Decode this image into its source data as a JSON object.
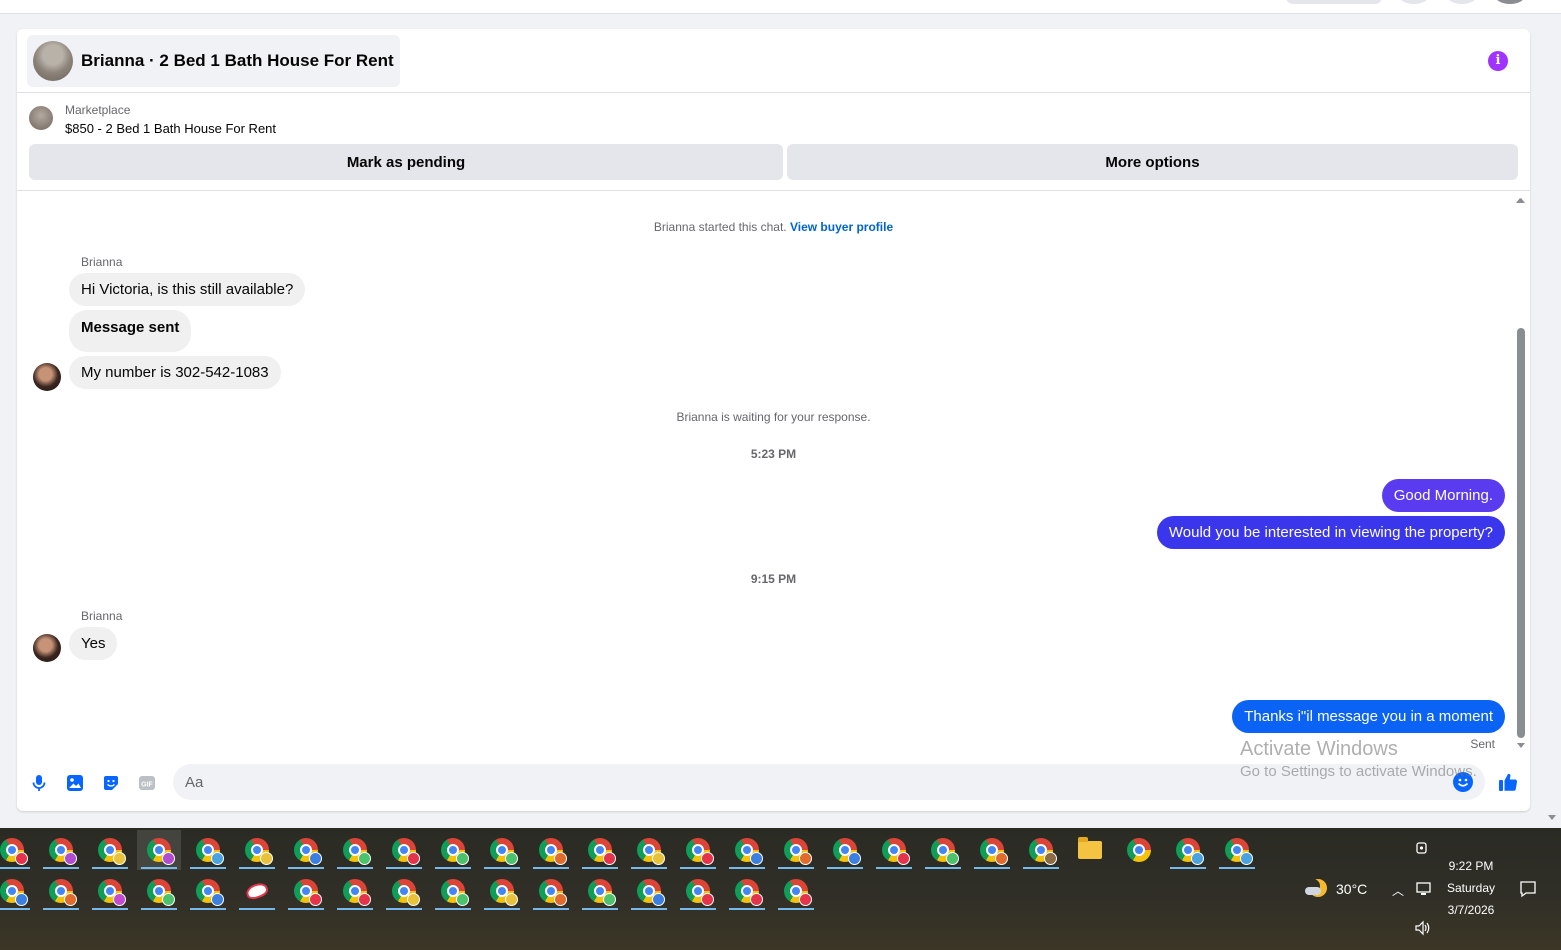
{
  "header": {
    "title": "Brianna · 2 Bed 1 Bath House For Rent",
    "info_icon": "i",
    "info_color": "#a033ff"
  },
  "listing": {
    "source": "Marketplace",
    "price_title": "$850 - 2 Bed 1 Bath House For Rent",
    "mark_pending_label": "Mark as pending",
    "more_options_label": "More options"
  },
  "chat": {
    "started_text": "Brianna started this chat.",
    "view_profile_label": "View buyer profile",
    "sender_name_1": "Brianna",
    "incoming_1": "Hi Victoria, is this still available?",
    "incoming_2": "Message sent",
    "incoming_3": "My number is 302-542-1083",
    "waiting_text": "Brianna is waiting for your response.",
    "time_1": "5:23 PM",
    "outgoing_1": "Good Morning.",
    "outgoing_2": "Would you be interested in viewing the property?",
    "time_2": "9:15 PM",
    "sender_name_2": "Brianna",
    "incoming_4": "Yes",
    "outgoing_3": "Thanks i\"il message you in a moment",
    "sent_status": "Sent",
    "outgoing_color_1": "#5b3bf0",
    "outgoing_color_2": "#3a36ec",
    "outgoing_color_3": "#0a63f5"
  },
  "composer": {
    "placeholder": "Aa",
    "icons": [
      "microphone-icon",
      "photo-icon",
      "sticker-icon",
      "gif-icon",
      "emoji-icon",
      "thumbs-up-icon"
    ],
    "gif_label": "GIF",
    "accent": "#0866ff"
  },
  "watermark": {
    "line1": "Activate Windows",
    "line2": "Go to Settings to activate Windows."
  },
  "taskbar": {
    "weather_temp": "30°C",
    "time": "9:22 PM",
    "day": "Saturday",
    "date": "3/7/2026",
    "row1_profile_colors": [
      "#e5334b",
      "#b24bd0",
      "#e7c23a",
      "#b24bd0",
      "#48a3e0",
      "#e7c23a",
      "#3b7fe0",
      "#4cc26c",
      "#e5334b",
      "#4cc26c",
      "#4cc26c",
      "#e06b2c",
      "#e5334b",
      "#e7c23a",
      "#e5334b",
      "#3b7fe0",
      "#e06b2c",
      "#3b7fe0",
      "#e5334b",
      "#4cc26c",
      "#e06b2c",
      "#8c6b45"
    ],
    "row2_profile_colors": [
      "#3b7fe0",
      "#e06b2c",
      "#c44bd0",
      "#4cc26c",
      "#3b7fe0",
      "#e5334b",
      "#e5334b",
      "#e7c23a",
      "#4cc26c",
      "#e7c23a",
      "#e06b2c",
      "#4cc26c",
      "#3b7fe0",
      "#e5334b",
      "#e5334b",
      "#e5334b"
    ]
  }
}
